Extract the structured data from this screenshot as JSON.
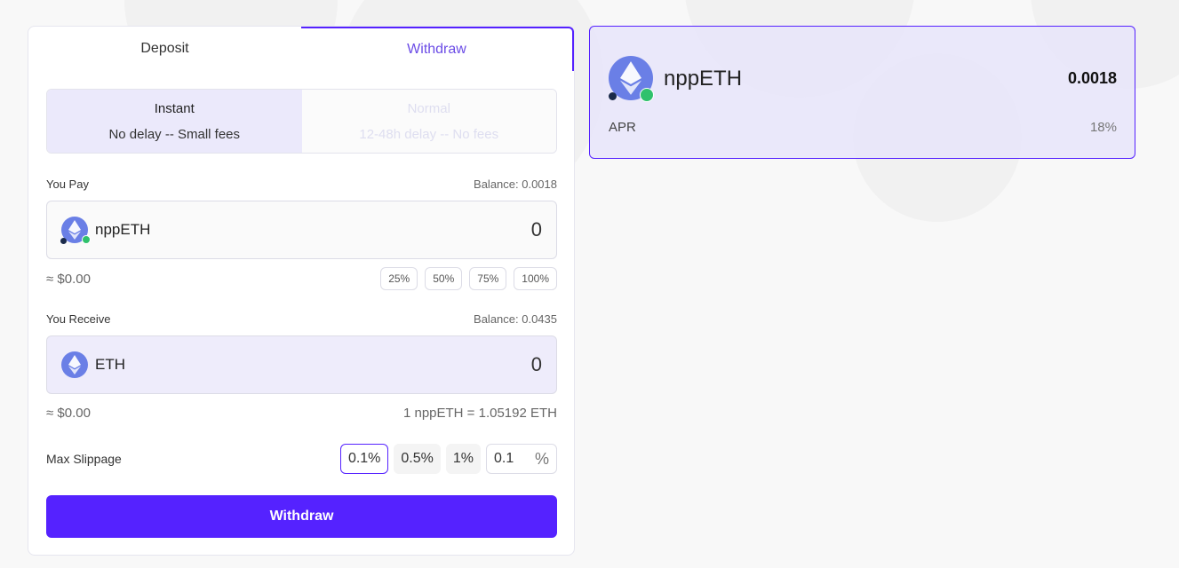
{
  "tabs": {
    "deposit": "Deposit",
    "withdraw": "Withdraw"
  },
  "mode": {
    "instant": {
      "title": "Instant",
      "subtitle": "No delay -- Small fees"
    },
    "normal": {
      "title": "Normal",
      "subtitle": "12-48h delay -- No fees"
    }
  },
  "pay": {
    "label": "You Pay",
    "balance": "Balance: 0.0018",
    "token": "nppETH",
    "amount": "0",
    "usd": "≈ $0.00",
    "percents": [
      "25%",
      "50%",
      "75%",
      "100%"
    ]
  },
  "receive": {
    "label": "You Receive",
    "balance": "Balance: 0.0435",
    "token": "ETH",
    "amount": "0",
    "usd": "≈ $0.00",
    "rate": "1 nppETH = 1.05192 ETH"
  },
  "slippage": {
    "label": "Max Slippage",
    "options": [
      "0.1%",
      "0.5%",
      "1%"
    ],
    "custom_value": "0.1",
    "custom_unit": "%"
  },
  "submit_label": "Withdraw",
  "info": {
    "token": "nppETH",
    "balance": "0.0018",
    "apr_label": "APR",
    "apr_value": "18%"
  },
  "icons": {
    "pay_token": "eth-icon",
    "receive_token": "eth-icon"
  },
  "colors": {
    "accent": "#5522ff",
    "instant_bg": "#ebe9fb",
    "receive_bg": "#eeecfb"
  }
}
